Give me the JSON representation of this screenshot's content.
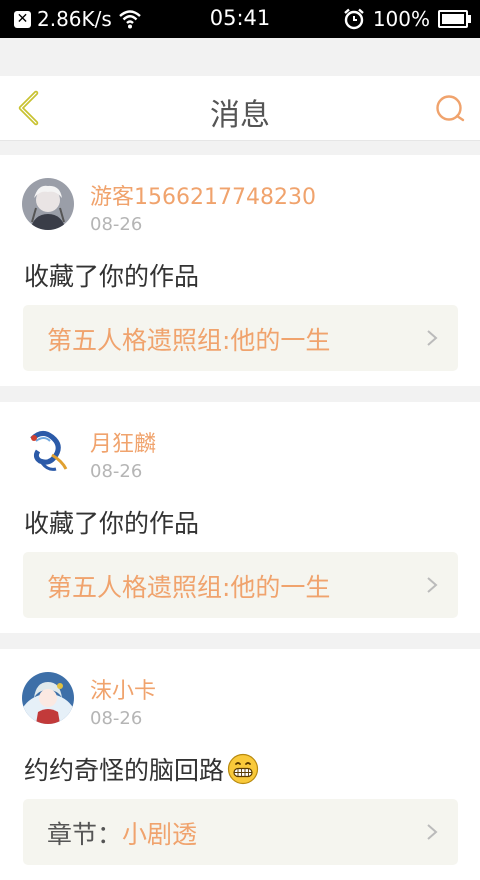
{
  "status_bar": {
    "speed": "2.86K/s",
    "time": "05:41",
    "battery": "100%",
    "battery_level": 1.0
  },
  "header": {
    "title": "消息"
  },
  "messages": [
    {
      "username": "游客1566217748230",
      "date": "08-26",
      "message": "收藏了你的作品",
      "link_prefix": "",
      "link_text": "第五人格遗照组:他的一生"
    },
    {
      "username": "月狂麟",
      "date": "08-26",
      "message": "收藏了你的作品",
      "link_prefix": "",
      "link_text": "第五人格遗照组:他的一生"
    },
    {
      "username": "沫小卡",
      "date": "08-26",
      "message": "约约奇怪的脑回路",
      "link_prefix": "章节：",
      "link_text": "小剧透"
    }
  ],
  "colors": {
    "accent": "#f0a36d",
    "back_icon": "#c8c230",
    "background": "#f2f2f2"
  },
  "icons": [
    "back-arrow-icon",
    "search-icon",
    "chevron-right-icon",
    "grin-emoji-icon",
    "wifi-icon",
    "alarm-icon",
    "battery-icon"
  ]
}
